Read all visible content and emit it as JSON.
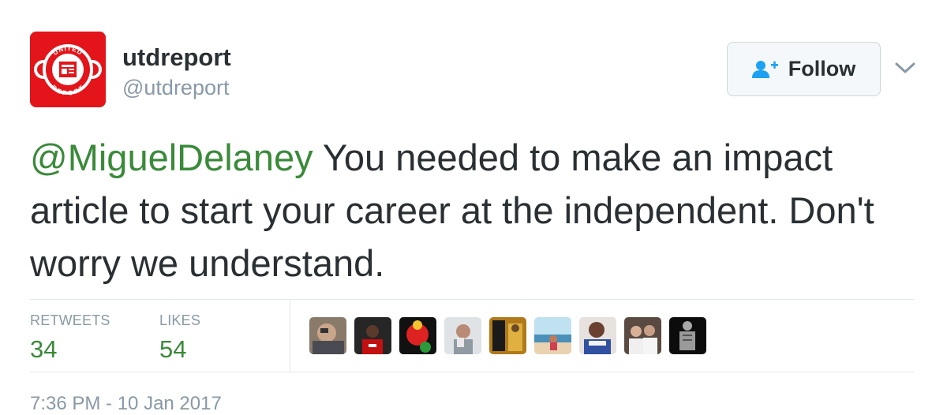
{
  "account": {
    "display_name": "utdreport",
    "handle": "@utdreport",
    "avatar_text_top": "UNITED",
    "avatar_text_bottom": "REPORT"
  },
  "follow_button": {
    "label": "Follow",
    "icon": "add-user-icon"
  },
  "menu": {
    "icon": "chevron-down-icon"
  },
  "tweet": {
    "mention": "@MiguelDelaney",
    "text": " You needed to make an impact article to start your career at the independent. Don't worry we understand."
  },
  "stats": {
    "retweets_label": "RETWEETS",
    "retweets_count": "34",
    "likes_label": "LIKES",
    "likes_count": "54"
  },
  "timestamp": "7:36 PM - 10 Jan 2017",
  "colors": {
    "accent_green": "#3a8a3a",
    "link_blue": "#1da1f2",
    "muted": "#8899a6",
    "avatar_red": "#e3151a"
  }
}
